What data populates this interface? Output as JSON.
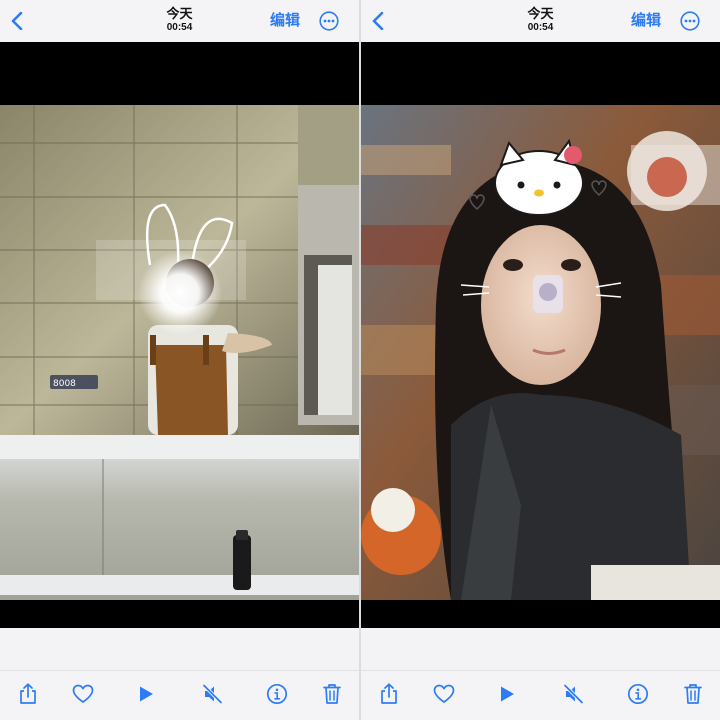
{
  "colors": {
    "accent": "#2d7cf6",
    "photo_background": "#000000",
    "bar_background": "#f4f4f6"
  },
  "panes": [
    {
      "nav": {
        "title": "今天",
        "subtitle": "00:54",
        "edit_label": "编辑",
        "back_icon": "chevron-left-icon",
        "more_icon": "more-circle-icon"
      },
      "photo": {
        "subject": "mirror-selfie-bathroom",
        "sign_text": "8008"
      },
      "toolbar": [
        "share-icon",
        "heart-icon",
        "play-icon",
        "mute-icon",
        "info-icon",
        "trash-icon"
      ]
    },
    {
      "nav": {
        "title": "今天",
        "subtitle": "00:54",
        "edit_label": "编辑",
        "back_icon": "chevron-left-icon",
        "more_icon": "more-circle-icon"
      },
      "photo": {
        "subject": "selfie-with-cat-stickers"
      },
      "toolbar": [
        "share-icon",
        "heart-icon",
        "play-icon",
        "mute-icon",
        "info-icon",
        "trash-icon"
      ]
    }
  ]
}
